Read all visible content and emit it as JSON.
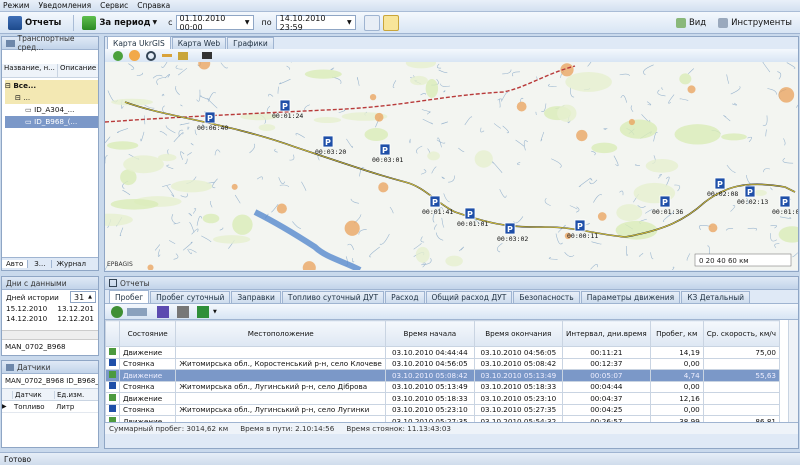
{
  "menu": [
    "Режим",
    "Уведомления",
    "Сервис",
    "Справка"
  ],
  "toolbar": {
    "reports": "Отчеты",
    "period": "За период",
    "from_label": "с",
    "from_value": "01.10.2010 00:00",
    "to_label": "по",
    "to_value": "14.10.2010 23:59",
    "view": "Вид",
    "tools": "Инструменты"
  },
  "vehicles": {
    "title": "Транспортные сред...",
    "col_name": "Название, н...",
    "col_desc": "Описание",
    "tree": [
      "Все...",
      "...",
      "ID_A304_...",
      "ID_B968_(..."
    ],
    "tabs": [
      "Авто",
      "З...",
      "Журнал"
    ]
  },
  "days": {
    "title": "Дни с данными",
    "history_label": "Дней истории",
    "history_value": "31",
    "rows": [
      [
        "15.12.2010",
        "13.12.201"
      ],
      [
        "14.12.2010",
        "12.12.201"
      ]
    ],
    "vehicle": "MAN_0702_B968"
  },
  "sensors": {
    "title": "Датчики",
    "vehicle": "MAN_0702_B968 ID_B968_(09",
    "col_sensor": "Датчик",
    "col_unit": "Ед.изм.",
    "rows": [
      [
        "Топливо",
        "Литр"
      ]
    ]
  },
  "map": {
    "tabs": [
      "Карта UkrGIS",
      "Карта Web",
      "Графики"
    ],
    "markers": [
      "00:06:40",
      "00:01:24",
      "00:03:20",
      "00:03:01",
      "00:01:41",
      "00:01:01",
      "00:03:02",
      "00:00:11",
      "00:01:36",
      "00:02:08",
      "00:02:13",
      "00:01:07"
    ],
    "scale": "0 20 40 60 км",
    "copyright": "EPBAGIS"
  },
  "reports": {
    "title": "Отчеты",
    "tabs": [
      "Пробег",
      "Пробег суточный",
      "Заправки",
      "Топливо суточный ДУТ",
      "Расход",
      "Общий расход ДУТ",
      "Безопасность",
      "Параметры движения",
      "КЗ Детальный"
    ],
    "columns": [
      "Состояние",
      "Местоположение",
      "Время начала",
      "Время окончания",
      "Интервал, дни.время",
      "Пробег, км",
      "Ср. скорость, км/ч"
    ],
    "rows": [
      [
        "Движение",
        "",
        "03.10.2010 04:44:44",
        "03.10.2010 04:56:05",
        "00:11:21",
        "14,19",
        "75,00"
      ],
      [
        "Стоянка",
        "Житомирська обл., Коростенський р-н, село Клочеве",
        "03.10.2010 04:56:05",
        "03.10.2010 05:08:42",
        "00:12:37",
        "0,00",
        ""
      ],
      [
        "Движение",
        "",
        "03.10.2010 05:08:42",
        "03.10.2010 05:13:49",
        "00:05:07",
        "4,74",
        "55,63"
      ],
      [
        "Стоянка",
        "Житомирська обл., Лугинський р-н, село Діброва",
        "03.10.2010 05:13:49",
        "03.10.2010 05:18:33",
        "00:04:44",
        "0,00",
        ""
      ],
      [
        "Движение",
        "",
        "03.10.2010 05:18:33",
        "03.10.2010 05:23:10",
        "00:04:37",
        "12,16",
        ""
      ],
      [
        "Стоянка",
        "Житомирська обл., Лугинський р-н, село Лугинки",
        "03.10.2010 05:23:10",
        "03.10.2010 05:27:35",
        "00:04:25",
        "0,00",
        ""
      ],
      [
        "Движение",
        "",
        "03.10.2010 05:27:35",
        "03.10.2010 05:54:32",
        "00:26:57",
        "38,99",
        "86,81"
      ]
    ],
    "summary": [
      "Суммарный пробег: 3014,62 км",
      "Время в пути: 2.10:14:56",
      "Время стоянок: 11.13:43:03"
    ]
  },
  "status": "Готово",
  "colors": {
    "accent": "#7b98c8",
    "park": "#1f4fa8",
    "route": "#111111"
  }
}
